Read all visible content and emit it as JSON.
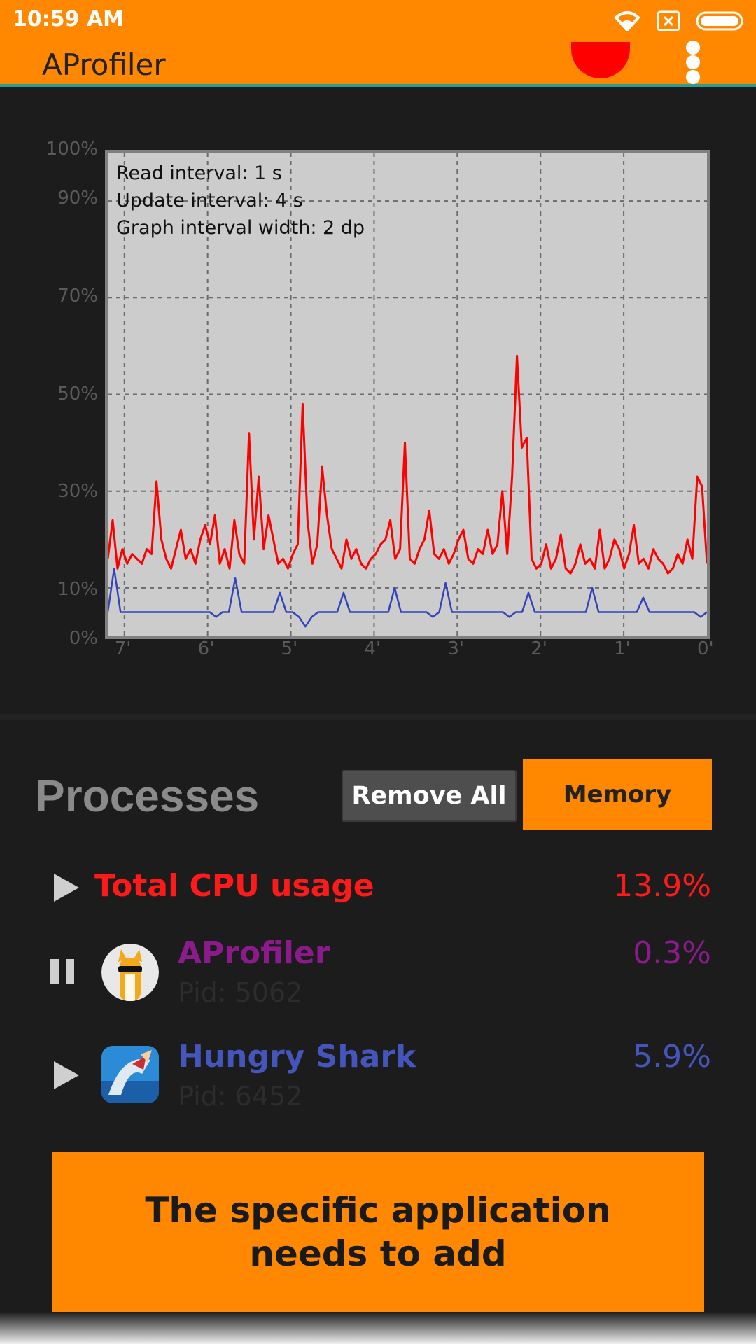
{
  "status_bar": {
    "time": "10:59 AM",
    "icons": [
      "wifi-icon",
      "sim-blocked-icon",
      "battery-icon"
    ]
  },
  "app_bar": {
    "title": "AProfiler",
    "accent_color": "#ff8800",
    "record_color": "#ff0000"
  },
  "graph": {
    "info_lines": [
      "Read interval: 1 s",
      "Update interval: 4 s",
      "Graph interval width: 2 dp"
    ],
    "y_ticks": [
      "100%",
      "90%",
      "70%",
      "50%",
      "30%",
      "10%",
      "0%"
    ],
    "x_ticks": [
      "7'",
      "6'",
      "5'",
      "4'",
      "3'",
      "2'",
      "1'",
      "0'"
    ]
  },
  "chart_data": {
    "type": "line",
    "ylim": [
      0,
      100
    ],
    "x_unit": "minutes ago",
    "xlim": [
      7.2,
      0
    ],
    "series": [
      {
        "color": "#ff0000",
        "values": [
          16,
          24,
          14,
          18,
          15,
          17,
          16,
          15,
          18,
          17,
          32,
          20,
          16,
          14,
          18,
          22,
          16,
          18,
          15,
          20,
          23,
          19,
          25,
          15,
          18,
          14,
          24,
          17,
          15,
          42,
          20,
          33,
          18,
          25,
          20,
          15,
          16,
          14,
          17,
          19,
          48,
          24,
          15,
          19,
          35,
          25,
          18,
          16,
          14,
          20,
          16,
          18,
          15,
          14,
          16,
          17,
          19,
          20,
          24,
          16,
          18,
          40,
          16,
          15,
          18,
          20,
          26,
          17,
          16,
          18,
          15,
          17,
          20,
          22,
          16,
          15,
          18,
          17,
          22,
          17,
          19,
          30,
          17,
          33,
          58,
          39,
          41,
          16,
          14,
          15,
          19,
          14,
          16,
          21,
          14,
          13,
          15,
          19,
          15,
          16,
          14,
          22,
          14,
          16,
          20,
          18,
          14,
          17,
          23,
          15,
          16,
          14,
          18,
          16,
          15,
          13,
          14,
          17,
          15,
          20,
          16,
          33,
          31,
          15
        ]
      },
      {
        "color": "#3344bb",
        "values": [
          5,
          14,
          5,
          5,
          5,
          5,
          5,
          5,
          5,
          5,
          5,
          5,
          5,
          5,
          5,
          5,
          5,
          4,
          5,
          5,
          12,
          5,
          5,
          5,
          5,
          5,
          5,
          9,
          5,
          5,
          4,
          2,
          4,
          5,
          5,
          5,
          5,
          9,
          5,
          5,
          5,
          5,
          5,
          5,
          5,
          10,
          5,
          5,
          5,
          5,
          5,
          4,
          5,
          11,
          5,
          5,
          5,
          5,
          5,
          5,
          5,
          5,
          5,
          4,
          5,
          5,
          9,
          5,
          5,
          5,
          5,
          5,
          5,
          5,
          5,
          5,
          10,
          5,
          5,
          5,
          5,
          5,
          5,
          5,
          8,
          5,
          5,
          5,
          5,
          5,
          5,
          5,
          5,
          4,
          5
        ]
      }
    ]
  },
  "processes": {
    "title": "Processes",
    "remove_all": "Remove All",
    "memory": "Memory",
    "total": {
      "label": "Total CPU usage",
      "value": "13.9%",
      "color": "#ff0000"
    },
    "items": [
      {
        "name": "AProfiler",
        "value": "0.3%",
        "pid": "Pid: 5062",
        "color": "#8b1a8b",
        "state": "paused"
      },
      {
        "name": "Hungry Shark",
        "value": "5.9%",
        "pid": "Pid: 6452",
        "color": "#4455bb",
        "state": "play"
      }
    ]
  },
  "banner": {
    "text": "The specific application needs to add"
  }
}
